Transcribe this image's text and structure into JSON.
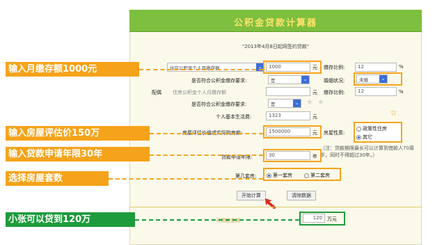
{
  "window": {
    "title": "公积金贷款计算器",
    "subtitle": "\"2013年4月8日起网签约贷款\""
  },
  "callouts": {
    "monthly_deposit": "输入月缴存额1000元",
    "valuation": "输入房屋评估价150万",
    "loan_term": "输入贷款申请年限30年",
    "house_count": "选择房屋套数",
    "result": "小张可以贷到120万"
  },
  "form": {
    "applicant_select": "住房公积金个人月缴存额",
    "monthly_deposit_value": "1000",
    "unit_yuan": "元",
    "deposit_ratio_label": "缴存比例:",
    "deposit_ratio_value": "12",
    "percent": "%",
    "meets_req_label": "是否符合公积金缴存要求:",
    "meets_req_value": "是",
    "marital_label": "婚姻状况:",
    "marital_value": "未婚",
    "spouse_label": "配偶",
    "spouse_select": "住房公积金个人月缴存额",
    "spouse_ratio_label": "缴存比例:",
    "spouse_ratio_value": "12",
    "spouse_meets_req_label": "是否符合公积金缴存要求:",
    "spouse_meets_req_value": "是",
    "living_cost_label": "个人基本生活费:",
    "living_cost_value": "1323",
    "valuation_label": "房屋评估价值或实际购房款:",
    "valuation_value": "1500000",
    "house_type_label": "房屋性质:",
    "house_type_options": [
      "政策性住房",
      "其它"
    ],
    "note": "（注：贷款期限最长可以计算到借款人70周岁，同时不得超过30年。）",
    "loan_term_label": "贷款申请年限:",
    "loan_term_value": "30",
    "unit_year": "年",
    "house_count_label": "第几套房:",
    "house_count_options": [
      "第一套房",
      "第二套房"
    ],
    "calc_button": "开始计算",
    "clear_button": "清除数据",
    "result_label": "可贷款金额",
    "result_value": "120",
    "result_unit": "万元"
  },
  "colors": {
    "header_green": "#7dbf3e",
    "callout_orange": "#f5a31a",
    "callout_green": "#1e9b3c",
    "title_yellow": "#ffe36b"
  }
}
